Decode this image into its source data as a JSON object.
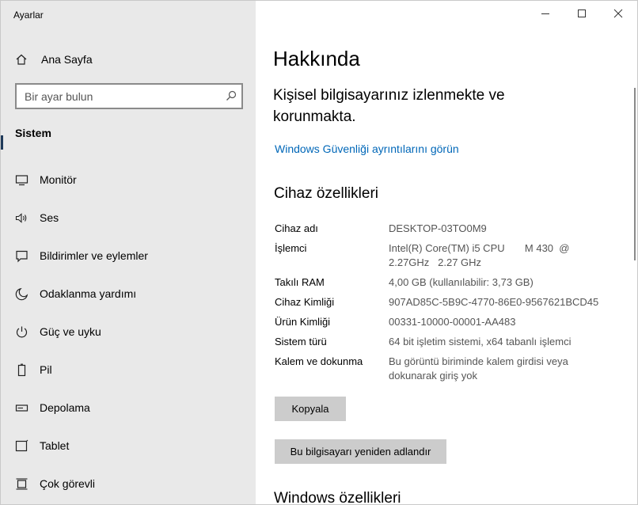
{
  "app": {
    "title": "Ayarlar"
  },
  "sidebar": {
    "home_label": "Ana Sayfa",
    "search_placeholder": "Bir ayar bulun",
    "section_label": "Sistem",
    "items": [
      {
        "label": "Monitör",
        "icon": "monitor-icon"
      },
      {
        "label": "Ses",
        "icon": "speaker-icon"
      },
      {
        "label": "Bildirimler ve eylemler",
        "icon": "notification-icon"
      },
      {
        "label": "Odaklanma yardımı",
        "icon": "moon-icon"
      },
      {
        "label": "Güç ve uyku",
        "icon": "power-icon"
      },
      {
        "label": "Pil",
        "icon": "battery-icon"
      },
      {
        "label": "Depolama",
        "icon": "storage-icon"
      },
      {
        "label": "Tablet",
        "icon": "tablet-icon"
      },
      {
        "label": "Çok görevli",
        "icon": "multitasking-icon"
      }
    ]
  },
  "main": {
    "title": "Hakkında",
    "protection_text": "Kişisel bilgisayarınız izlenmekte ve korunmakta.",
    "security_link": "Windows Güvenliği ayrıntılarını görün",
    "device_heading": "Cihaz özellikleri",
    "specs": [
      {
        "key": "Cihaz adı",
        "value": "DESKTOP-03TO0M9"
      },
      {
        "key": "İşlemci",
        "value": "Intel(R) Core(TM) i5 CPU       M 430  @ 2.27GHz   2.27 GHz"
      },
      {
        "key": "Takılı RAM",
        "value": "4,00 GB (kullanılabilir: 3,73 GB)"
      },
      {
        "key": "Cihaz Kimliği",
        "value": "907AD85C-5B9C-4770-86E0-9567621BCD45"
      },
      {
        "key": "Ürün Kimliği",
        "value": "00331-10000-00001-AA483"
      },
      {
        "key": "Sistem türü",
        "value": "64 bit işletim sistemi, x64 tabanlı işlemci"
      },
      {
        "key": "Kalem ve dokunma",
        "value": "Bu görüntü biriminde kalem girdisi veya dokunarak giriş yok"
      }
    ],
    "copy_button": "Kopyala",
    "rename_button": "Bu bilgisayarı yeniden adlandır",
    "windows_heading": "Windows özellikleri"
  }
}
